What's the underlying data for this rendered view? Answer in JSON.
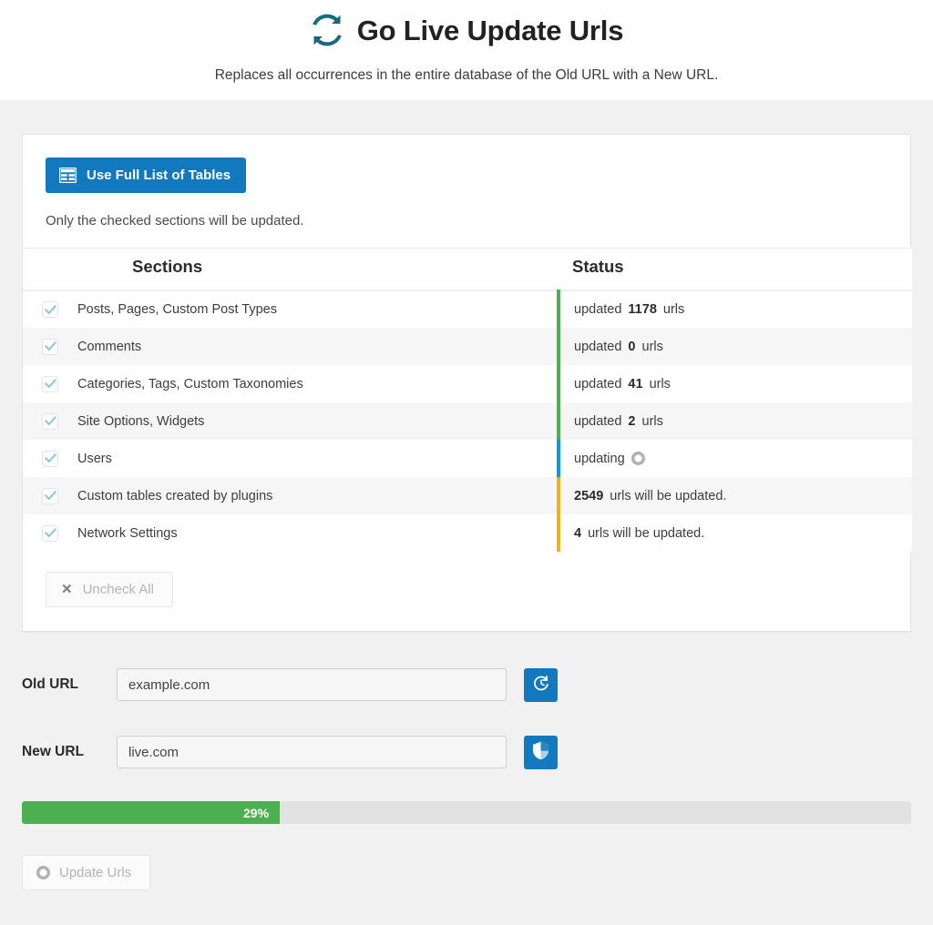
{
  "header": {
    "icon": "sync-refresh-icon",
    "title": "Go Live Update Urls",
    "subtitle": "Replaces all occurrences in the entire database of the Old URL with a New URL."
  },
  "card": {
    "full_list_button": {
      "label": "Use Full List of Tables",
      "icon": "table-icon"
    },
    "hint": "Only the checked sections will be updated.",
    "columns": {
      "sections": "Sections",
      "status": "Status"
    },
    "rows": [
      {
        "checked": true,
        "name": "Posts, Pages, Custom Post Types",
        "state": "done",
        "prefix": "updated",
        "count": "1178",
        "suffix": "urls"
      },
      {
        "checked": true,
        "name": "Comments",
        "state": "done",
        "prefix": "updated",
        "count": "0",
        "suffix": "urls"
      },
      {
        "checked": true,
        "name": "Categories, Tags, Custom Taxonomies",
        "state": "done",
        "prefix": "updated",
        "count": "41",
        "suffix": "urls"
      },
      {
        "checked": true,
        "name": "Site Options, Widgets",
        "state": "done",
        "prefix": "updated",
        "count": "2",
        "suffix": "urls"
      },
      {
        "checked": true,
        "name": "Users",
        "state": "running",
        "prefix": "updating",
        "count": "",
        "suffix": ""
      },
      {
        "checked": true,
        "name": "Custom tables created by plugins",
        "state": "pending",
        "prefix": "",
        "count": "2549",
        "suffix": "urls will be updated."
      },
      {
        "checked": true,
        "name": "Network Settings",
        "state": "pending",
        "prefix": "",
        "count": "4",
        "suffix": "urls will be updated."
      }
    ],
    "uncheck_all_button": {
      "label": "Uncheck All",
      "icon": "close-x-icon"
    }
  },
  "form": {
    "old_url": {
      "label": "Old URL",
      "value": "example.com",
      "placeholder": "Old URL",
      "action_icon": "history-icon"
    },
    "new_url": {
      "label": "New URL",
      "value": "live.com",
      "placeholder": "New URL",
      "action_icon": "shield-icon"
    }
  },
  "progress": {
    "percent_label": "29%",
    "percent": 29
  },
  "update_button": {
    "label": "Update Urls",
    "icon": "spinner-ring-icon"
  },
  "colors": {
    "accent_blue": "#1279be",
    "title_teal": "#17697f",
    "done_green": "#4cb050",
    "running_blue": "#0a9ad6",
    "pending_orange": "#f2b01e",
    "page_bg": "#f1f1f1"
  }
}
